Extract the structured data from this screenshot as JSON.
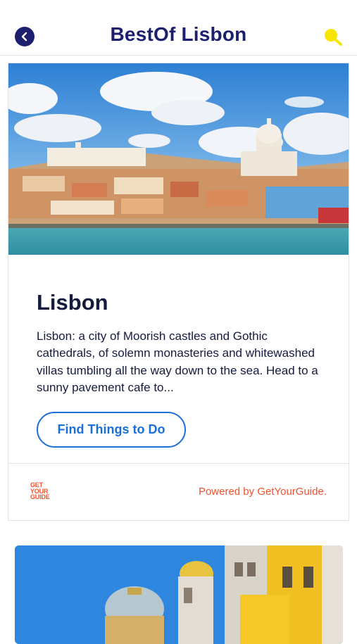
{
  "header": {
    "title": "BestOf Lisbon",
    "back_icon": "back-arrow-icon",
    "search_icon": "search-icon",
    "accent_color": "#1c1f6e",
    "search_color": "#f7e600"
  },
  "card": {
    "image_name": "lisbon-cityscape",
    "heading": "Lisbon",
    "description": "Lisbon: a city of Moorish castles and Gothic cathedrals, of solemn monasteries and whitewashed villas tumbling all the way down to the sea. Head to a sunny pavement cafe to...",
    "cta_label": "Find Things to Do",
    "cta_color": "#1b6fd8",
    "footer": {
      "logo_lines": [
        "GET",
        "YOUR",
        "GUIDE"
      ],
      "powered_by": "Powered by GetYourGuide.",
      "brand_color": "#f4522d"
    }
  },
  "next_card": {
    "image_name": "pena-palace"
  }
}
